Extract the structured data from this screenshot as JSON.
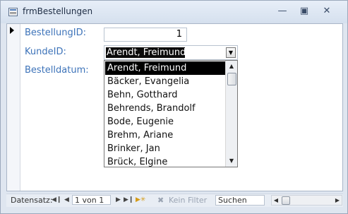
{
  "window": {
    "title": "frmBestellungen"
  },
  "form": {
    "bestellung_id": {
      "label": "BestellungID:",
      "value": "1"
    },
    "kunde_id": {
      "label": "KundeID:",
      "value": "Arendt, Freimund"
    },
    "bestelldatum": {
      "label": "Bestelldatum:"
    }
  },
  "dropdown": {
    "items": [
      "Arendt, Freimund",
      "Bäcker, Evangelia",
      "Behn, Gotthard",
      "Behrends, Brandolf",
      "Bode, Eugenie",
      "Brehm, Ariane",
      "Brinker, Jan",
      "Brück, Elgine"
    ],
    "selected_index": 0
  },
  "navigation": {
    "label": "Datensatz:",
    "record": "1 von 1",
    "filter_label": "Kein Filter",
    "search_label": "Suchen"
  },
  "icons": {
    "first": "first-record-icon",
    "prev": "previous-record-icon",
    "next": "next-record-icon",
    "last": "last-record-icon",
    "new": "new-record-icon"
  },
  "colors": {
    "label": "#3d73b9",
    "selection": "#000000",
    "title_bar": "#dfe6f0"
  }
}
